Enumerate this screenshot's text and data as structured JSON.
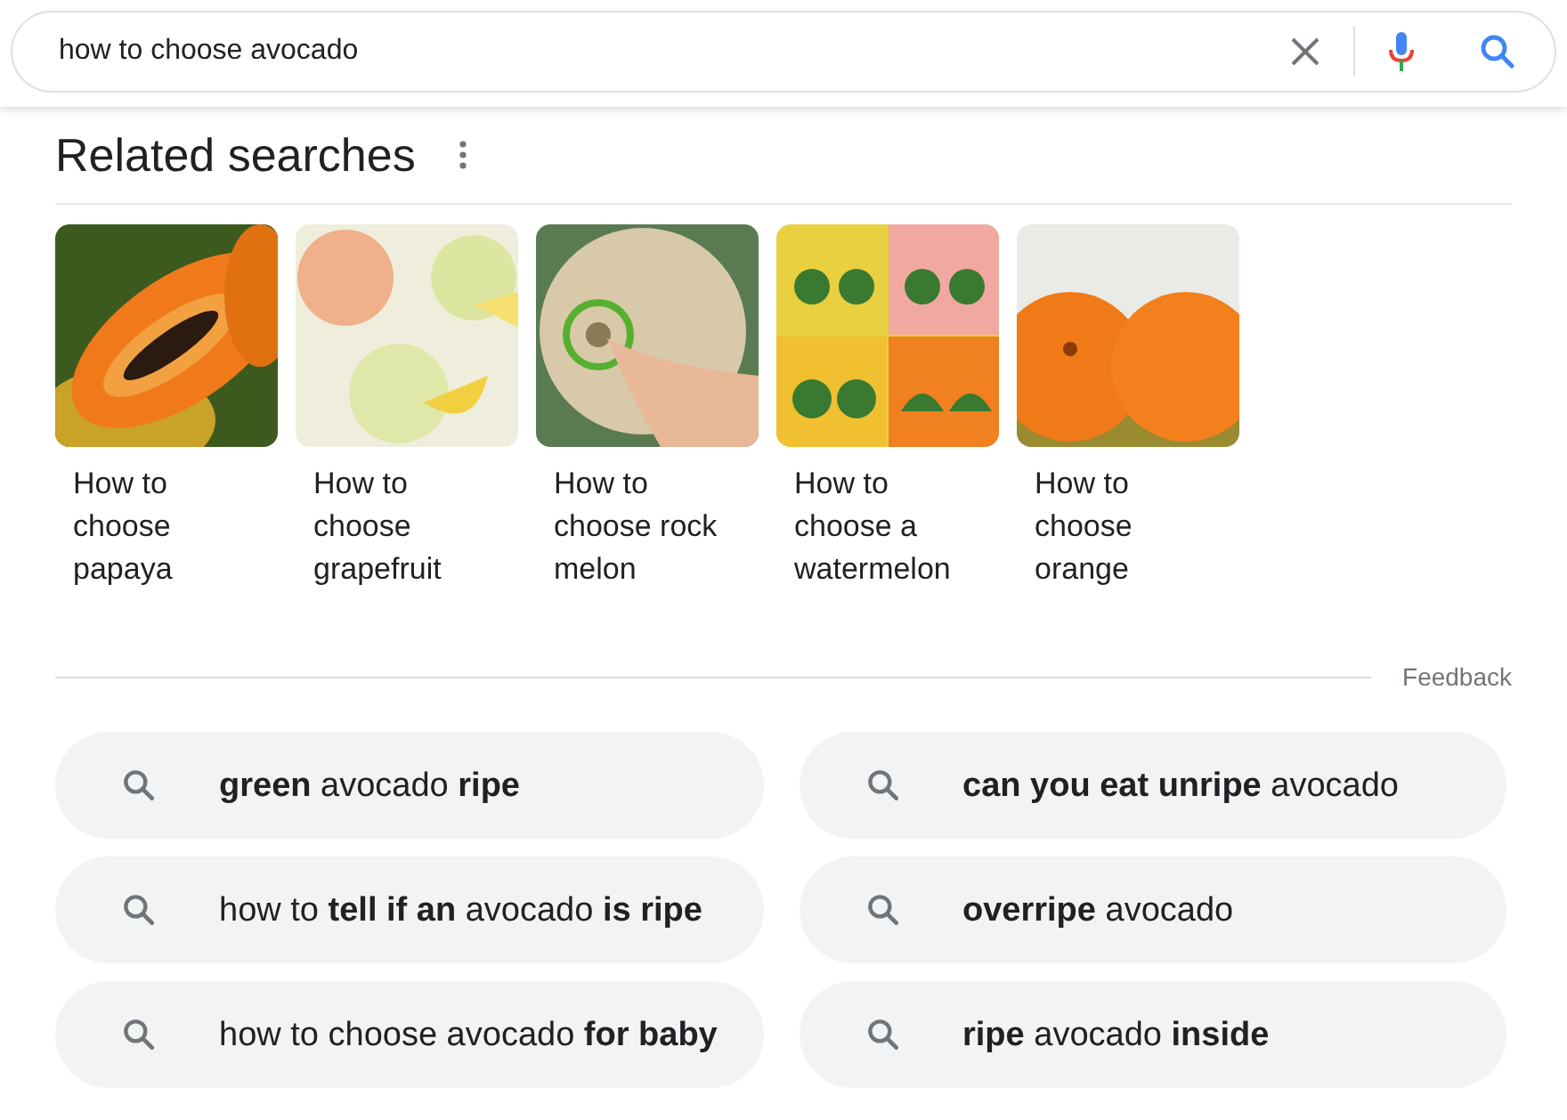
{
  "search": {
    "value": "how to choose avocado"
  },
  "related": {
    "title": "Related searches",
    "cards": [
      {
        "label": "How to choose papaya"
      },
      {
        "label": "How to choose grapefruit"
      },
      {
        "label": "How to choose rock melon"
      },
      {
        "label": "How to choose a watermelon"
      },
      {
        "label": "How to choose orange"
      }
    ],
    "feedback": "Feedback"
  },
  "suggestions": [
    {
      "text": "**green** avocado **ripe**"
    },
    {
      "text": "**can you eat unripe** avocado"
    },
    {
      "text": "how to **tell if an** avocado **is ripe**"
    },
    {
      "text": "**overripe** avocado"
    },
    {
      "text": "how to choose avocado **for baby**"
    },
    {
      "text": "**ripe** avocado **inside**"
    }
  ]
}
